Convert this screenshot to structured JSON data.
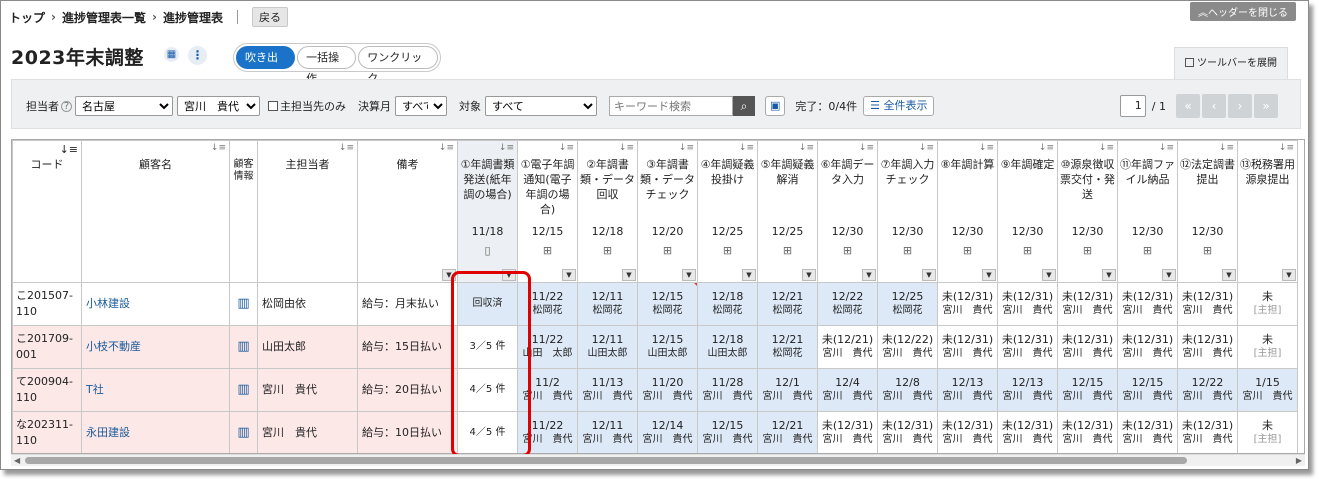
{
  "breadcrumb": {
    "home": "トップ",
    "list": "進捗管理表一覧",
    "current": "進捗管理表",
    "back": "戻る"
  },
  "header_close": "ヘッダーを閉じる",
  "page_title": "2023年末調整",
  "modes": [
    "吹き出し",
    "一括操作",
    "ワンクリック"
  ],
  "toolbar_expand": "ツールバーを展開",
  "filters": {
    "manager_label": "担当者",
    "manager_region": "名古屋",
    "manager_person": "宮川　貴代",
    "primary_only_label": "主担当先のみ",
    "close_month_label": "決算月",
    "close_month": "すべて",
    "target_label": "対象",
    "target": "すべて",
    "keyword_placeholder": "キーワード検索",
    "done_label": "完了：0/4件",
    "show_all": "全件表示"
  },
  "pager": {
    "page": "1",
    "total": "/ 1"
  },
  "columns": {
    "code": "コード",
    "name": "顧客名",
    "info": "顧客情報",
    "manager": "主担当者",
    "memo": "備考"
  },
  "tasks": [
    {
      "title": "①年調書類発送(紙年調の場合)",
      "date": "11/18"
    },
    {
      "title": "①電子年調通知(電子年調の場合)",
      "date": "12/15"
    },
    {
      "title": "②年調書類・データ回収",
      "date": "12/18"
    },
    {
      "title": "③年調書類・データチェック",
      "date": "12/20"
    },
    {
      "title": "④年調疑義投掛け",
      "date": "12/25"
    },
    {
      "title": "⑤年調疑義解消",
      "date": "12/25"
    },
    {
      "title": "⑥年調データ入力",
      "date": "12/30"
    },
    {
      "title": "⑦年調入力チェック",
      "date": "12/30"
    },
    {
      "title": "⑧年調計算",
      "date": "12/30"
    },
    {
      "title": "⑨年調確定",
      "date": "12/30"
    },
    {
      "title": "⑩源泉徴収票交付・発送",
      "date": "12/30"
    },
    {
      "title": "⑪年調ファイル納品",
      "date": "12/30"
    },
    {
      "title": "⑫法定調書提出",
      "date": "12/30"
    },
    {
      "title": "⑬税務署用源泉提出",
      "date": ""
    }
  ],
  "rows": [
    {
      "code": "こ201507-110",
      "name": "小林建設",
      "manager": "松岡由依",
      "memo": "給与：月末払い",
      "count": "回収済",
      "cells": [
        [
          "11/22",
          "松岡花"
        ],
        [
          "12/11",
          "松岡花"
        ],
        [
          "12/15",
          "松岡花"
        ],
        [
          "12/18",
          "松岡花"
        ],
        [
          "12/21",
          "松岡花"
        ],
        [
          "12/22",
          "松岡花"
        ],
        [
          "12/25",
          "松岡花"
        ],
        [
          "未(12/31)",
          "宮川　貴代"
        ],
        [
          "未(12/31)",
          "宮川　貴代"
        ],
        [
          "未(12/31)",
          "宮川　貴代"
        ],
        [
          "未(12/31)",
          "宮川　貴代"
        ],
        [
          "未(12/31)",
          "宮川　貴代"
        ],
        [
          "未",
          "[主担]"
        ]
      ]
    },
    {
      "code": "こ201709-001",
      "name": "小枝不動産",
      "manager": "山田太郎",
      "memo": "給与：15日払い",
      "count": "3／5 件",
      "cells": [
        [
          "11/22",
          "山田　太郎"
        ],
        [
          "12/11",
          "山田太郎"
        ],
        [
          "12/15",
          "山田太郎"
        ],
        [
          "12/18",
          "山田太郎"
        ],
        [
          "12/21",
          "松岡花"
        ],
        [
          "未(12/21)",
          "宮川　貴代"
        ],
        [
          "未(12/22)",
          "宮川　貴代"
        ],
        [
          "未(12/31)",
          "宮川　貴代"
        ],
        [
          "未(12/31)",
          "宮川　貴代"
        ],
        [
          "未(12/31)",
          "宮川　貴代"
        ],
        [
          "未(12/31)",
          "宮川　貴代"
        ],
        [
          "未(12/31)",
          "宮川　貴代"
        ],
        [
          "未",
          "[主担]"
        ]
      ]
    },
    {
      "code": "て200904-110",
      "name": "T社",
      "manager": "宮川　貴代",
      "memo": "給与：20日払い",
      "count": "4／5 件",
      "cells": [
        [
          "11/2",
          "宮川　貴代"
        ],
        [
          "11/13",
          "宮川　貴代"
        ],
        [
          "11/20",
          "宮川　貴代"
        ],
        [
          "11/28",
          "宮川　貴代"
        ],
        [
          "12/1",
          "宮川　貴代"
        ],
        [
          "12/4",
          "宮川　貴代"
        ],
        [
          "12/8",
          "宮川　貴代"
        ],
        [
          "12/13",
          "宮川　貴代"
        ],
        [
          "12/13",
          "宮川　貴代"
        ],
        [
          "12/15",
          "宮川　貴代"
        ],
        [
          "12/15",
          "宮川　貴代"
        ],
        [
          "12/22",
          "宮川　貴代"
        ],
        [
          "1/15",
          "宮川　貴代"
        ]
      ]
    },
    {
      "code": "な202311-110",
      "name": "永田建設",
      "manager": "宮川　貴代",
      "memo": "給与：10日払い",
      "count": "4／5 件",
      "cells": [
        [
          "11/22",
          "宮川　貴代"
        ],
        [
          "12/11",
          "宮川　貴代"
        ],
        [
          "12/14",
          "宮川　貴代"
        ],
        [
          "12/15",
          "宮川　貴代"
        ],
        [
          "12/21",
          "宮川　貴代"
        ],
        [
          "未(12/31)",
          "宮川　貴代"
        ],
        [
          "未(12/31)",
          "宮川　貴代"
        ],
        [
          "未(12/31)",
          "宮川　貴代"
        ],
        [
          "未(12/31)",
          "宮川　貴代"
        ],
        [
          "未(12/31)",
          "宮川　貴代"
        ],
        [
          "未(12/31)",
          "宮川　貴代"
        ],
        [
          "未(12/31)",
          "宮川　貴代"
        ],
        [
          "未",
          "[主担]"
        ]
      ]
    }
  ],
  "highlight_color": "#dde9f7",
  "pink_color": "#fde8e8",
  "accent": "#1a73c8"
}
